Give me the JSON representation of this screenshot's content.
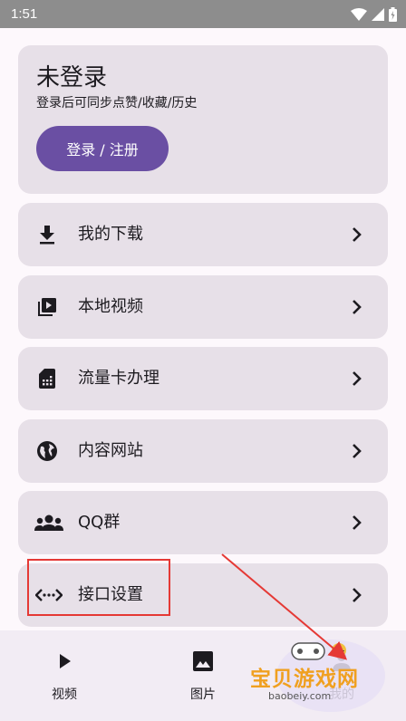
{
  "status_bar": {
    "time": "1:51"
  },
  "login": {
    "title": "未登录",
    "subtitle": "登录后可同步点赞/收藏/历史",
    "button_label": "登录 / 注册"
  },
  "menu": {
    "items": [
      {
        "label": "我的下载",
        "icon": "download-icon"
      },
      {
        "label": "本地视频",
        "icon": "video-library-icon"
      },
      {
        "label": "流量卡办理",
        "icon": "sim-card-icon"
      },
      {
        "label": "内容网站",
        "icon": "globe-icon"
      },
      {
        "label": "QQ群",
        "icon": "group-icon"
      },
      {
        "label": "接口设置",
        "icon": "code-dots-icon"
      }
    ]
  },
  "bottom_nav": {
    "items": [
      {
        "label": "视频",
        "icon": "play-icon"
      },
      {
        "label": "图片",
        "icon": "image-icon"
      },
      {
        "label": "我的",
        "icon": "person-icon"
      }
    ]
  },
  "watermark": {
    "text": "宝贝游戏网",
    "url": "baobeiy.com"
  },
  "colors": {
    "accent": "#6a4fa3",
    "card": "#e7e0e8",
    "background": "#fdf8fc",
    "highlight": "#e53935"
  }
}
